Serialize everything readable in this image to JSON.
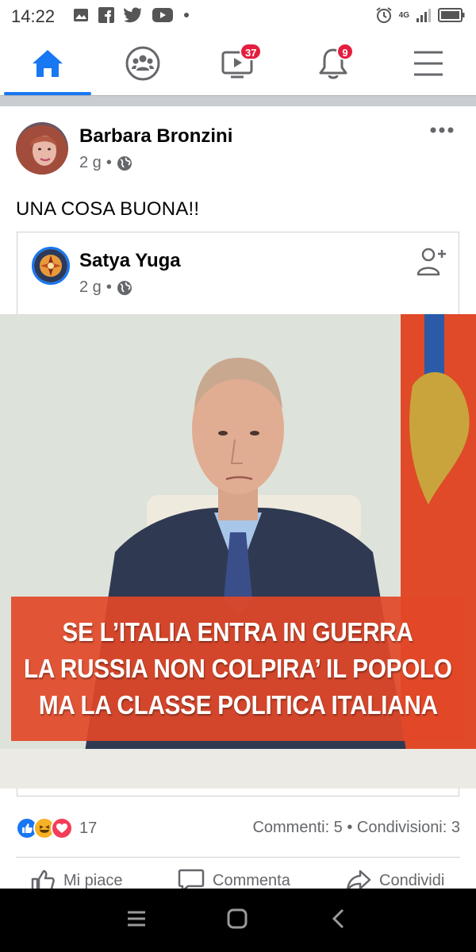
{
  "status_bar": {
    "time": "14:22",
    "network": "4G",
    "left_icons": [
      "image-icon",
      "facebook-icon",
      "twitter-icon",
      "youtube-icon",
      "dot-icon"
    ],
    "right_icons": [
      "alarm-icon",
      "signal-icon",
      "battery-icon"
    ]
  },
  "tabs": [
    {
      "name": "home",
      "icon": "home-icon",
      "active": true,
      "badge": ""
    },
    {
      "name": "groups",
      "icon": "groups-icon",
      "active": false,
      "badge": ""
    },
    {
      "name": "watch",
      "icon": "video-icon",
      "active": false,
      "badge": "37"
    },
    {
      "name": "notifications",
      "icon": "bell-icon",
      "active": false,
      "badge": "9"
    },
    {
      "name": "menu",
      "icon": "menu-icon",
      "active": false,
      "badge": ""
    }
  ],
  "post": {
    "author": "Barbara Bronzini",
    "time": "2 g",
    "separator": "•",
    "text": "UNA COSA BUONA!!",
    "shared": {
      "author": "Satya Yuga",
      "time": "2 g",
      "separator": "•",
      "image_caption": [
        "SE L’ITALIA ENTRA IN GUERRA",
        "LA RUSSIA NON COLPIRA’ IL POPOLO",
        "MA LA CLASSE POLITICA ITALIANA"
      ]
    },
    "reactions": {
      "types": [
        "like",
        "haha",
        "love"
      ],
      "count": "17"
    },
    "stats": "Commenti: 5 • Condivisioni: 3",
    "actions": {
      "like": "Mi piace",
      "comment": "Commenta",
      "share": "Condividi"
    }
  },
  "colors": {
    "accent": "#1877f2",
    "badge": "#e41e3f",
    "caption_bg": "#e24828",
    "muted": "#65676b"
  }
}
